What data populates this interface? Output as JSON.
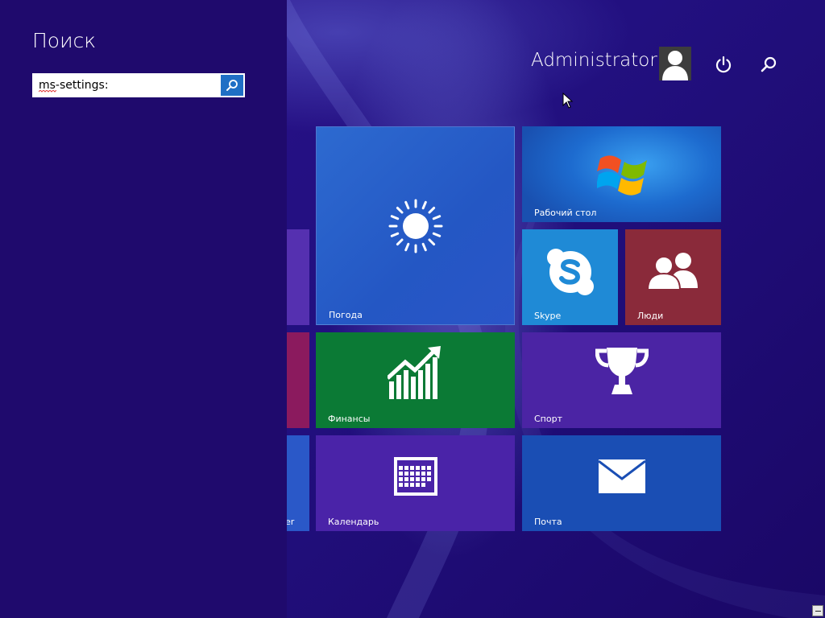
{
  "search": {
    "title": "Поиск",
    "value": "ms-settings:",
    "placeholder": ""
  },
  "header": {
    "user_name": "Administrator"
  },
  "tiles": {
    "weather": {
      "label": "Погода",
      "icon": "sun-icon"
    },
    "desktop": {
      "label": "Рабочий стол",
      "icon": "windows-logo-icon"
    },
    "skype": {
      "label": "Skype",
      "icon": "skype-icon"
    },
    "people": {
      "label": "Люди",
      "icon": "people-icon"
    },
    "finance": {
      "label": "Финансы",
      "icon": "chart-up-icon"
    },
    "sport": {
      "label": "Спорт",
      "icon": "trophy-icon"
    },
    "calendar": {
      "label": "Календарь",
      "icon": "calendar-icon"
    },
    "mail": {
      "label": "Почта",
      "icon": "envelope-icon"
    },
    "partial_bottom": {
      "label": "er"
    }
  },
  "colors": {
    "start_background": "#1f0a6e",
    "search_accent": "#1f6fc5",
    "weather": "#2457c4",
    "desktop": "#1d6bcf",
    "skype": "#1f8ad6",
    "people": "#8a2a3a",
    "finance": "#0b7a35",
    "sport": "#4b24a4",
    "calendar": "#4a23a8",
    "mail": "#1a4eb4"
  }
}
